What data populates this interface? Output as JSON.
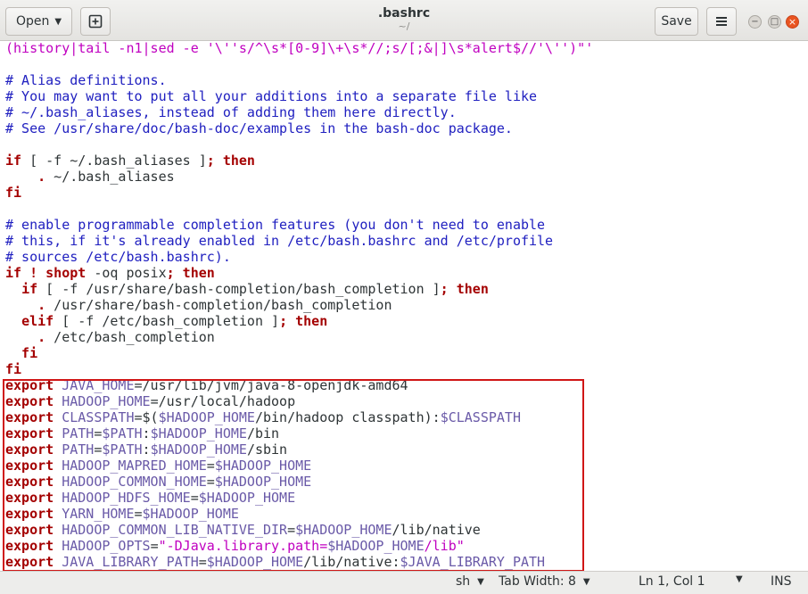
{
  "window": {
    "title": ".bashrc",
    "subtitle": "~/"
  },
  "toolbar": {
    "open_label": "Open",
    "save_label": "Save",
    "icons": [
      "new-tab-icon",
      "hamburger-menu-icon",
      "minimize-icon",
      "maximize-icon",
      "close-icon"
    ]
  },
  "editor": {
    "lines": [
      [
        {
          "t": "(history|tail -n1|sed -e '\\''s/^\\s*[0-9]\\+\\s*//;s/[;&|]\\s*alert$//'\\'')\"'",
          "c": "str"
        }
      ],
      [],
      [
        {
          "t": "# Alias definitions.",
          "c": "cm"
        }
      ],
      [
        {
          "t": "# You may want to put all your additions into a separate file like",
          "c": "cm"
        }
      ],
      [
        {
          "t": "# ~/.bash_aliases, instead of adding them here directly.",
          "c": "cm"
        }
      ],
      [
        {
          "t": "# See /usr/share/doc/bash-doc/examples in the bash-doc package.",
          "c": "cm"
        }
      ],
      [],
      [
        {
          "t": "if",
          "c": "kw"
        },
        {
          "t": " [ -f ~/.bash_aliases ]",
          "c": "pth"
        },
        {
          "t": "; ",
          "c": "kw"
        },
        {
          "t": "then",
          "c": "kw"
        }
      ],
      [
        {
          "t": "    ",
          "c": "pth"
        },
        {
          "t": ".",
          "c": "kw"
        },
        {
          "t": " ~/.bash_aliases",
          "c": "pth"
        }
      ],
      [
        {
          "t": "fi",
          "c": "kw"
        }
      ],
      [],
      [
        {
          "t": "# enable programmable completion features (you don't need to enable",
          "c": "cm"
        }
      ],
      [
        {
          "t": "# this, if it's already enabled in /etc/bash.bashrc and /etc/profile",
          "c": "cm"
        }
      ],
      [
        {
          "t": "# sources /etc/bash.bashrc).",
          "c": "cm"
        }
      ],
      [
        {
          "t": "if ! shopt",
          "c": "kw"
        },
        {
          "t": " -oq posix",
          "c": "pth"
        },
        {
          "t": "; then",
          "c": "kw"
        }
      ],
      [
        {
          "t": "  ",
          "c": "pth"
        },
        {
          "t": "if",
          "c": "kw"
        },
        {
          "t": " [ -f ",
          "c": "pth"
        },
        {
          "t": "/usr/share/bash-completion/bash_completion ]",
          "c": "pth"
        },
        {
          "t": "; then",
          "c": "kw"
        }
      ],
      [
        {
          "t": "    ",
          "c": "pth"
        },
        {
          "t": ".",
          "c": "kw"
        },
        {
          "t": " /usr/share/bash-completion/bash_completion",
          "c": "pth"
        }
      ],
      [
        {
          "t": "  ",
          "c": "pth"
        },
        {
          "t": "elif",
          "c": "kw"
        },
        {
          "t": " [ -f ",
          "c": "pth"
        },
        {
          "t": "/etc/bash_completion ]",
          "c": "pth"
        },
        {
          "t": "; then",
          "c": "kw"
        }
      ],
      [
        {
          "t": "    ",
          "c": "pth"
        },
        {
          "t": ".",
          "c": "kw"
        },
        {
          "t": " /etc/bash_completion",
          "c": "pth"
        }
      ],
      [
        {
          "t": "  fi",
          "c": "kw"
        }
      ],
      [
        {
          "t": "fi",
          "c": "kw"
        }
      ],
      [
        {
          "t": "export",
          "c": "kw"
        },
        {
          "t": " JAVA_HOME",
          "c": "vr"
        },
        {
          "t": "=/usr/lib/jvm/java-8-openjdk-amd64",
          "c": "pth"
        }
      ],
      [
        {
          "t": "export",
          "c": "kw"
        },
        {
          "t": " HADOOP_HOME",
          "c": "vr"
        },
        {
          "t": "=/usr/local/hadoop",
          "c": "pth"
        }
      ],
      [
        {
          "t": "export",
          "c": "kw"
        },
        {
          "t": " CLASSPATH",
          "c": "vr"
        },
        {
          "t": "=$(",
          "c": "pth"
        },
        {
          "t": "$HADOOP_HOME",
          "c": "vr"
        },
        {
          "t": "/bin/hadoop classpath):",
          "c": "pth"
        },
        {
          "t": "$CLASSPATH",
          "c": "vr"
        }
      ],
      [
        {
          "t": "export",
          "c": "kw"
        },
        {
          "t": " PATH",
          "c": "vr"
        },
        {
          "t": "=",
          "c": "pth"
        },
        {
          "t": "$PATH",
          "c": "vr"
        },
        {
          "t": ":",
          "c": "pth"
        },
        {
          "t": "$HADOOP_HOME",
          "c": "vr"
        },
        {
          "t": "/bin",
          "c": "pth"
        }
      ],
      [
        {
          "t": "export",
          "c": "kw"
        },
        {
          "t": " PATH",
          "c": "vr"
        },
        {
          "t": "=",
          "c": "pth"
        },
        {
          "t": "$PATH",
          "c": "vr"
        },
        {
          "t": ":",
          "c": "pth"
        },
        {
          "t": "$HADOOP_HOME",
          "c": "vr"
        },
        {
          "t": "/sbin",
          "c": "pth"
        }
      ],
      [
        {
          "t": "export",
          "c": "kw"
        },
        {
          "t": " HADOOP_MAPRED_HOME",
          "c": "vr"
        },
        {
          "t": "=",
          "c": "pth"
        },
        {
          "t": "$HADOOP_HOME",
          "c": "vr"
        }
      ],
      [
        {
          "t": "export",
          "c": "kw"
        },
        {
          "t": " HADOOP_COMMON_HOME",
          "c": "vr"
        },
        {
          "t": "=",
          "c": "pth"
        },
        {
          "t": "$HADOOP_HOME",
          "c": "vr"
        }
      ],
      [
        {
          "t": "export",
          "c": "kw"
        },
        {
          "t": " HADOOP_HDFS_HOME",
          "c": "vr"
        },
        {
          "t": "=",
          "c": "pth"
        },
        {
          "t": "$HADOOP_HOME",
          "c": "vr"
        }
      ],
      [
        {
          "t": "export",
          "c": "kw"
        },
        {
          "t": " YARN_HOME",
          "c": "vr"
        },
        {
          "t": "=",
          "c": "pth"
        },
        {
          "t": "$HADOOP_HOME",
          "c": "vr"
        }
      ],
      [
        {
          "t": "export",
          "c": "kw"
        },
        {
          "t": " HADOOP_COMMON_LIB_NATIVE_DIR",
          "c": "vr"
        },
        {
          "t": "=",
          "c": "pth"
        },
        {
          "t": "$HADOOP_HOME",
          "c": "vr"
        },
        {
          "t": "/lib/native",
          "c": "pth"
        }
      ],
      [
        {
          "t": "export",
          "c": "kw"
        },
        {
          "t": " HADOOP_OPTS",
          "c": "vr"
        },
        {
          "t": "=",
          "c": "pth"
        },
        {
          "t": "\"-DJava.library.path=",
          "c": "str"
        },
        {
          "t": "$HADOOP_HOME",
          "c": "vr"
        },
        {
          "t": "/lib\"",
          "c": "str"
        }
      ],
      [
        {
          "t": "export",
          "c": "kw"
        },
        {
          "t": " JAVA_LIBRARY_PATH",
          "c": "vr"
        },
        {
          "t": "=",
          "c": "pth"
        },
        {
          "t": "$HADOOP_HOME",
          "c": "vr"
        },
        {
          "t": "/lib/native:",
          "c": "pth"
        },
        {
          "t": "$JAVA_LIBRARY_PATH",
          "c": "vr"
        }
      ]
    ],
    "colors": {
      "keyword": "#a40000",
      "comment": "#2020c0",
      "variable": "#6a5aa8",
      "string": "#c000c0",
      "plain": "#2e3436",
      "highlight_box": "#d01616"
    }
  },
  "statusbar": {
    "language": "sh",
    "tab_width": "Tab Width: 8",
    "position": "Ln 1, Col 1",
    "mode": "INS"
  }
}
